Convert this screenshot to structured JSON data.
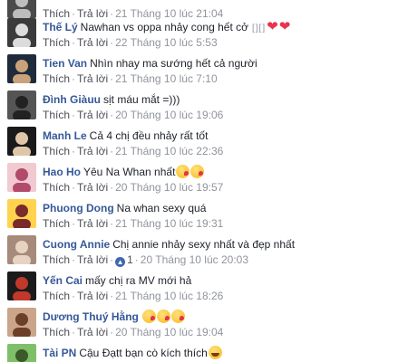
{
  "labels": {
    "like": "Thích",
    "reply": "Trả lời",
    "separator": "·"
  },
  "colors": {
    "author": "#365899",
    "meta": "#90949c",
    "accent": "#4267b2"
  },
  "comments": [
    {
      "author": "",
      "text": "",
      "time": "21 Tháng 10 lúc 21:04",
      "extras": [],
      "like_count": null
    },
    {
      "author": "Thế Lý",
      "text": "Nawhan vs oppa nhảy cong hết cở",
      "time": "22 Tháng 10 lúc 5:53",
      "extras": [
        "squares-glyph",
        "heart-icon",
        "heart-icon"
      ],
      "like_count": null,
      "squares": "[][]"
    },
    {
      "author": "Tien Van",
      "text": "Nhìn nhay ma sướng hết cả người",
      "time": "21 Tháng 10 lúc 7:10",
      "extras": [],
      "like_count": null
    },
    {
      "author": "Đình Giàuu",
      "text": "sịt máu mắt =)))",
      "time": "20 Tháng 10 lúc 19:06",
      "extras": [],
      "like_count": null
    },
    {
      "author": "Manh Le",
      "text": "Cả 4 chị đều nhảy rất tốt",
      "time": "21 Tháng 10 lúc 22:36",
      "extras": [],
      "like_count": null
    },
    {
      "author": "Hao Ho",
      "text": "Yêu Na Whan nhất",
      "time": "20 Tháng 10 lúc 19:57",
      "extras": [
        "kiss-emoji-icon",
        "kiss-emoji-icon"
      ],
      "like_count": null
    },
    {
      "author": "Phuong Dong",
      "text": "Na whan sexy quá",
      "time": "21 Tháng 10 lúc 19:31",
      "extras": [],
      "like_count": null
    },
    {
      "author": "Cuong Annie",
      "text": "Chị annie nhảy sexy nhất và đẹp nhất",
      "time": "20 Tháng 10 lúc 20:03",
      "extras": [],
      "like_count": "1"
    },
    {
      "author": "Yến Cai",
      "text": "mấy chị ra MV mới hả",
      "time": "21 Tháng 10 lúc 18:26",
      "extras": [],
      "like_count": null
    },
    {
      "author": "Dương Thuý Hằng",
      "text": "",
      "time": "20 Tháng 10 lúc 19:04",
      "extras": [
        "kiss-emoji-icon",
        "kiss-emoji-icon",
        "kiss-emoji-icon"
      ],
      "like_count": null
    },
    {
      "author": "Tài PN",
      "text": "Cậu Đạtt bạn cò kích thích",
      "time": "",
      "extras": [
        "laugh-emoji-icon"
      ],
      "like_count": null
    }
  ]
}
